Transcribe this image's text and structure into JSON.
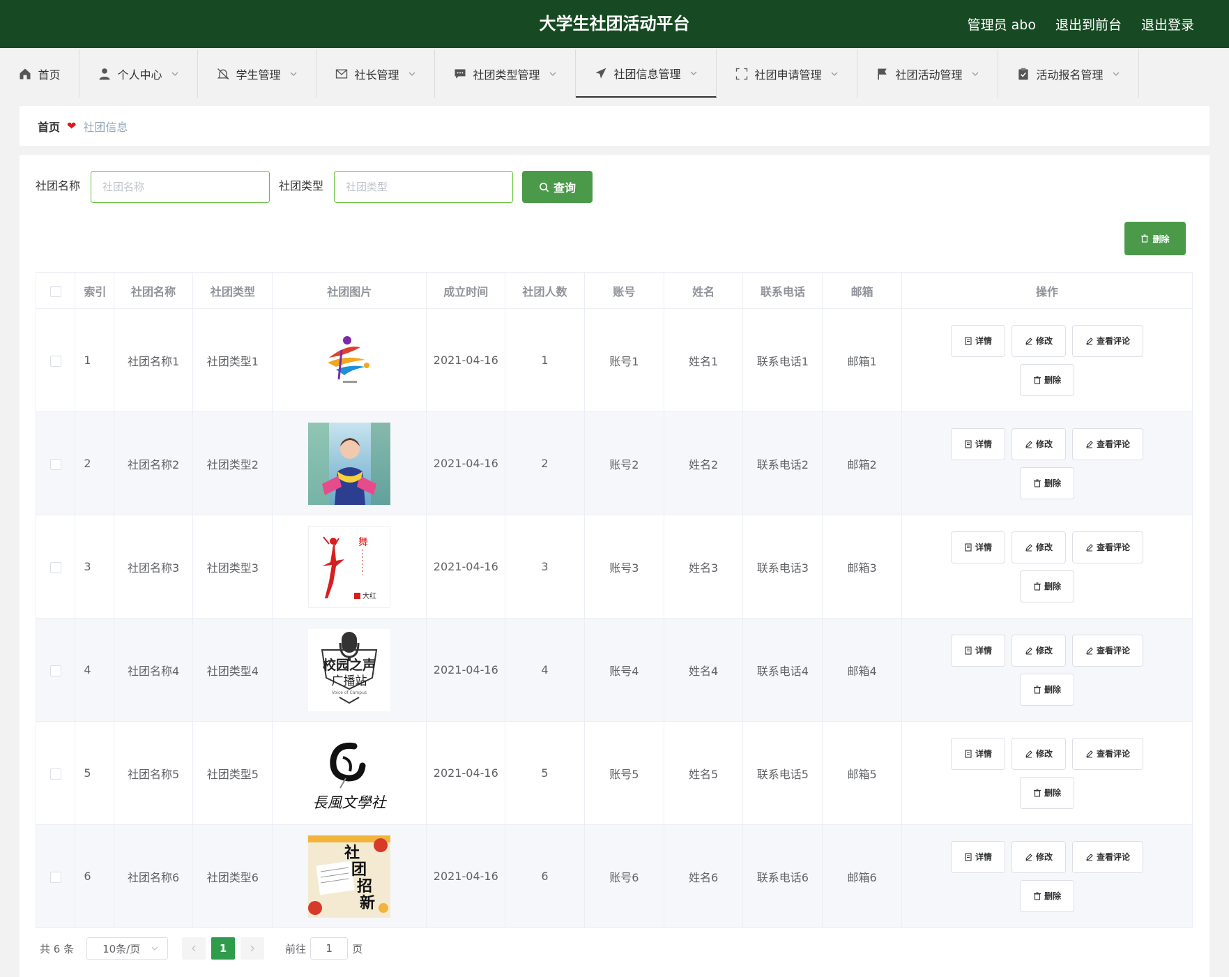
{
  "header": {
    "title": "大学生社团活动平台",
    "admin": "管理员 abo",
    "to_front": "退出到前台",
    "logout": "退出登录"
  },
  "nav": [
    {
      "label": "首页",
      "icon": "home-icon"
    },
    {
      "label": "个人中心",
      "icon": "user-icon"
    },
    {
      "label": "学生管理",
      "icon": "bell-off-icon"
    },
    {
      "label": "社长管理",
      "icon": "mail-icon"
    },
    {
      "label": "社团类型管理",
      "icon": "chat-icon"
    },
    {
      "label": "社团信息管理",
      "icon": "send-icon"
    },
    {
      "label": "社团申请管理",
      "icon": "fullscreen-icon"
    },
    {
      "label": "社团活动管理",
      "icon": "flag-icon"
    },
    {
      "label": "活动报名管理",
      "icon": "clipboard-icon"
    }
  ],
  "breadcrumb": {
    "home": "首页",
    "current": "社团信息"
  },
  "search": {
    "name_label": "社团名称",
    "name_placeholder": "社团名称",
    "type_label": "社团类型",
    "type_placeholder": "社团类型",
    "query_button": "查询",
    "delete_button": "删除"
  },
  "table": {
    "headers": [
      "索引",
      "社团名称",
      "社团类型",
      "社团图片",
      "成立时间",
      "社团人数",
      "账号",
      "姓名",
      "联系电话",
      "邮箱",
      "操作"
    ],
    "rows": [
      {
        "index": "1",
        "name": "社团名称1",
        "type": "社团类型1",
        "image": "dance-logo",
        "date": "2021-04-16",
        "count": "1",
        "account": "账号1",
        "person": "姓名1",
        "phone": "联系电话1",
        "email": "邮箱1"
      },
      {
        "index": "2",
        "name": "社团名称2",
        "type": "社团类型2",
        "image": "girl-photo",
        "date": "2021-04-16",
        "count": "2",
        "account": "账号2",
        "person": "姓名2",
        "phone": "联系电话2",
        "email": "邮箱2"
      },
      {
        "index": "3",
        "name": "社团名称3",
        "type": "社团类型3",
        "image": "ballet-poster",
        "date": "2021-04-16",
        "count": "3",
        "account": "账号3",
        "person": "姓名3",
        "phone": "联系电话3",
        "email": "邮箱3"
      },
      {
        "index": "4",
        "name": "社团名称4",
        "type": "社团类型4",
        "image": "radio-logo",
        "date": "2021-04-16",
        "count": "4",
        "account": "账号4",
        "person": "姓名4",
        "phone": "联系电话4",
        "email": "邮箱4"
      },
      {
        "index": "5",
        "name": "社团名称5",
        "type": "社团类型5",
        "image": "literature-logo",
        "date": "2021-04-16",
        "count": "5",
        "account": "账号5",
        "person": "姓名5",
        "phone": "联系电话5",
        "email": "邮箱5"
      },
      {
        "index": "6",
        "name": "社团名称6",
        "type": "社团类型6",
        "image": "recruit-poster",
        "date": "2021-04-16",
        "count": "6",
        "account": "账号6",
        "person": "姓名6",
        "phone": "联系电话6",
        "email": "邮箱6"
      }
    ],
    "actions": {
      "detail": "详情",
      "edit": "修改",
      "comments": "查看评论",
      "delete": "删除"
    }
  },
  "images": {
    "ballet_caption": "大红",
    "radio_text1": "校园之声",
    "radio_text2": "广播站",
    "radio_sub": "Voice of Campus",
    "literature_text": "長風文學社",
    "recruit_text": [
      "社",
      "团",
      "招",
      "新"
    ]
  },
  "pagination": {
    "total": "共 6 条",
    "page_size": "10条/页",
    "current_page": "1",
    "goto_label": "前往",
    "goto_value": "1",
    "page_suffix": "页"
  },
  "colors": {
    "header_bg": "#174a23",
    "primary_green": "#4a9a49",
    "active_page": "#2e9c4a",
    "breadcrumb_heart": "#e01818"
  }
}
